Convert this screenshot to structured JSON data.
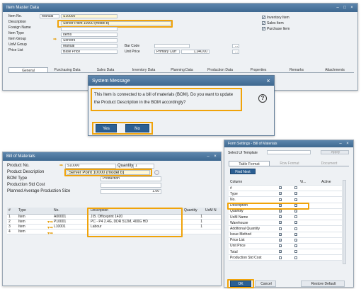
{
  "item_master": {
    "title": "Item Master Data",
    "labels": [
      "Item No.",
      "Description",
      "Foreign Name",
      "Item Type",
      "Item Group",
      "UoM Group",
      "Price List"
    ],
    "item_no_series": "Manual",
    "item_no": "S10000",
    "description": "Server Point 10000 (model b)",
    "item_type": "Items",
    "item_group": "Servers",
    "uom_group": "Manual",
    "price_list": "Base Price",
    "bar_code_label": "Bar Code",
    "unit_price_label": "Unit Price",
    "unit_price_currency": "Primary Curr",
    "unit_price_value": "1,040.00",
    "checkboxes": [
      "Inventory Item",
      "Sales Item",
      "Purchase Item"
    ],
    "tabs": [
      "General",
      "Purchasing Data",
      "Sales Data",
      "Inventory Data",
      "Planning Data",
      "Production Data",
      "Properties",
      "Remarks",
      "Attachments"
    ]
  },
  "system_message": {
    "title": "System Message",
    "text": "This Item is connected to a bill of materials (BOM). Do you want to update the Product Description in the BOM accordingly?",
    "yes": "Yes",
    "no": "No"
  },
  "bom": {
    "title": "Bill of Materials",
    "labels": [
      "Product No.",
      "Product Description",
      "BOM Type",
      "Production Std Cost",
      "Planned Average Production Size"
    ],
    "product_no": "S10000",
    "quantity_label": "Quantity",
    "quantity": "1",
    "product_description": "Server Point 10000 (model b)",
    "bom_type": "Production",
    "planned_avg_size": "1.00",
    "columns": [
      "#",
      "Type",
      "No.",
      "Description",
      "Quantity",
      "UoM N"
    ],
    "rows": [
      {
        "n": "1",
        "type": "Item",
        "no": "A00001",
        "desc": "J.B. Officeprint 1420",
        "qty": "1"
      },
      {
        "n": "2",
        "type": "Item",
        "no": "P10001",
        "desc": "PC - P4 2.4G, DDR 512M, 400G HD",
        "qty": "1"
      },
      {
        "n": "3",
        "type": "Item",
        "no": "L10001",
        "desc": "Labour",
        "qty": "1"
      },
      {
        "n": "4",
        "type": "Item",
        "no": "",
        "desc": "",
        "qty": ""
      }
    ]
  },
  "form_settings": {
    "title": "Form Settings - Bill of Materials",
    "select_template": "Select UI Template",
    "apply": "Apply",
    "tabs": [
      "Table Format",
      "Row Format",
      "Document"
    ],
    "find_next": "Find Next",
    "columns": [
      "Column",
      "Vi...",
      "Active"
    ],
    "rows": [
      {
        "name": "#",
        "vis": true,
        "act": false
      },
      {
        "name": "Type",
        "vis": true,
        "act": true
      },
      {
        "name": "No.",
        "vis": true,
        "act": true
      },
      {
        "name": "Description",
        "vis": true,
        "act": true
      },
      {
        "name": "Quantity",
        "vis": true,
        "act": true
      },
      {
        "name": "UoM Name",
        "vis": true,
        "act": false
      },
      {
        "name": "Warehouse",
        "vis": true,
        "act": true
      },
      {
        "name": "Additional Quantity",
        "vis": false,
        "act": false
      },
      {
        "name": "Issue Method",
        "vis": true,
        "act": true
      },
      {
        "name": "Price List",
        "vis": true,
        "act": true
      },
      {
        "name": "Unit Price",
        "vis": true,
        "act": true
      },
      {
        "name": "Total",
        "vis": true,
        "act": false
      },
      {
        "name": "Production Std Cost",
        "vis": false,
        "act": false
      }
    ],
    "ok": "OK",
    "cancel": "Cancel",
    "restore": "Restore Default"
  },
  "colors": {
    "highlight": "#f0a30a",
    "titlebar": "#3e6890",
    "button_blue": "#2b5f93"
  }
}
